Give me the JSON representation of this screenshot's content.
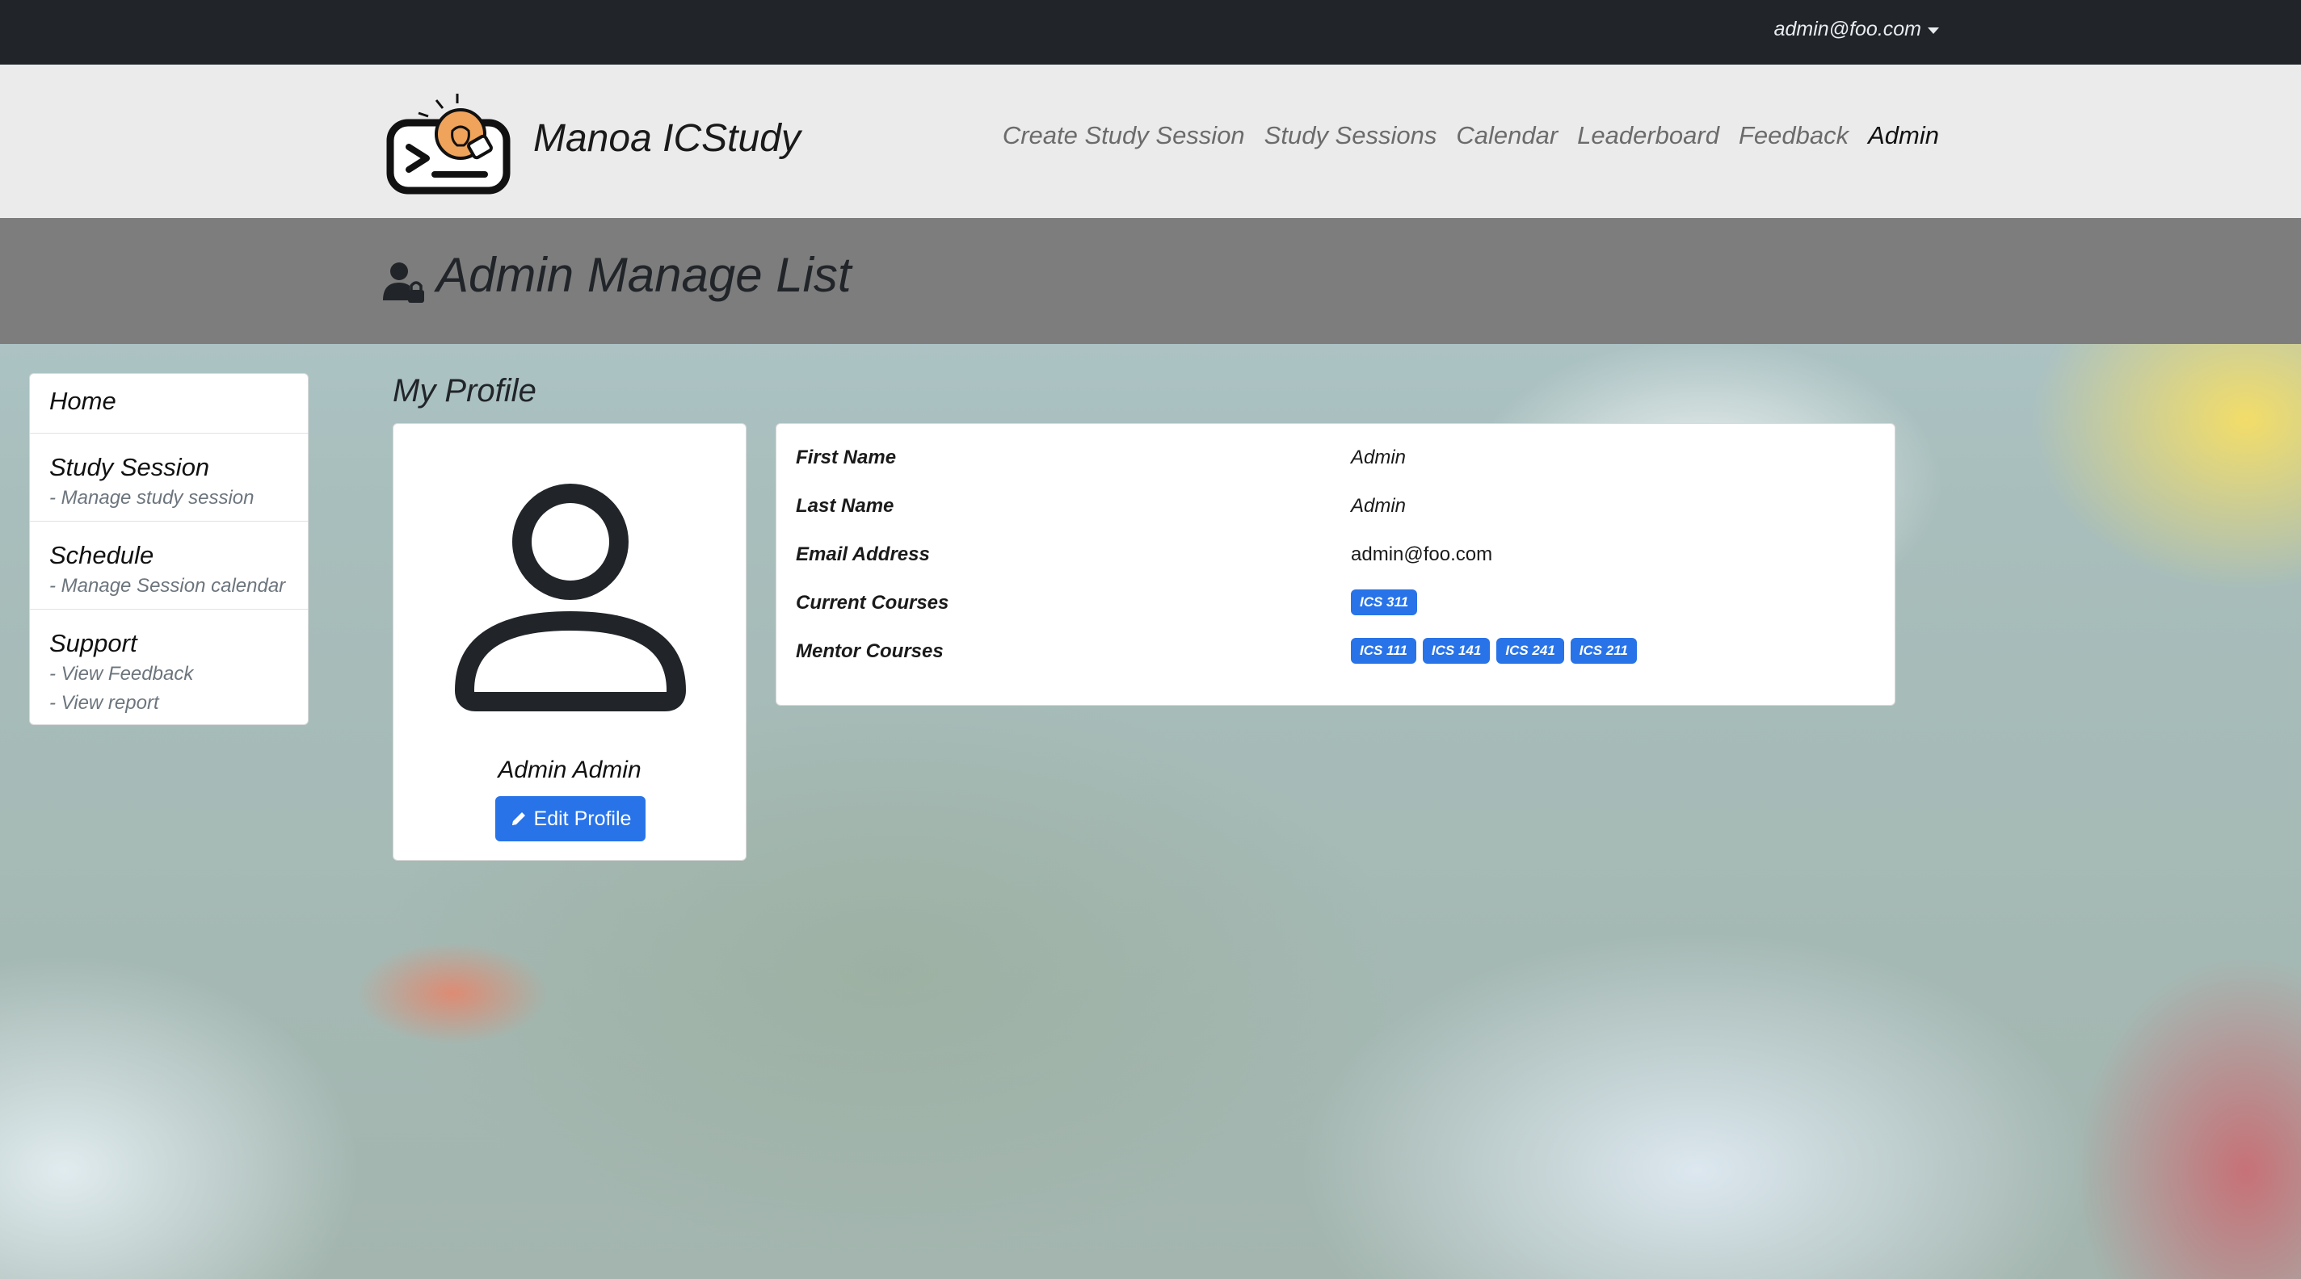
{
  "topbar": {
    "user_email": "admin@foo.com"
  },
  "brand": {
    "name": "Manoa ICStudy"
  },
  "nav": {
    "items": [
      {
        "label": "Create Study Session"
      },
      {
        "label": "Study Sessions"
      },
      {
        "label": "Calendar"
      },
      {
        "label": "Leaderboard"
      },
      {
        "label": "Feedback"
      },
      {
        "label": "Admin"
      }
    ]
  },
  "header": {
    "title": "Admin Manage List",
    "icon": "user-lock-icon"
  },
  "sidebar": {
    "home": "Home",
    "study_session": {
      "title": "Study Session",
      "sub": "- Manage study session"
    },
    "schedule": {
      "title": "Schedule",
      "sub": "- Manage Session calendar"
    },
    "support": {
      "title": "Support",
      "sub1": "- View Feedback",
      "sub2": "- View report"
    }
  },
  "profile": {
    "heading": "My Profile",
    "name": "Admin Admin",
    "edit_label": "Edit Profile"
  },
  "details": {
    "first_name_label": "First Name",
    "first_name": "Admin",
    "last_name_label": "Last Name",
    "last_name": "Admin",
    "email_label": "Email Address",
    "email": "admin@foo.com",
    "current_courses_label": "Current Courses",
    "current_courses": [
      "ICS 311"
    ],
    "mentor_courses_label": "Mentor Courses",
    "mentor_courses": [
      "ICS 111",
      "ICS 141",
      "ICS 241",
      "ICS 211"
    ]
  },
  "colors": {
    "topbar": "#212529",
    "navbar": "#ebebeb",
    "header_band": "#7d7d7d",
    "primary": "#2873e8",
    "logo_bulb": "#f0a35a"
  }
}
